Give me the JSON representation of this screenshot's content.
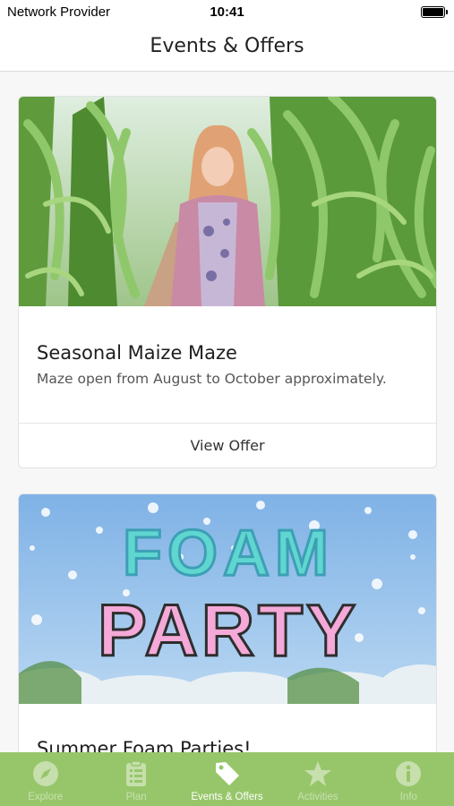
{
  "status_bar": {
    "carrier": "Network Provider",
    "time": "10:41"
  },
  "header": {
    "title": "Events & Offers"
  },
  "offers": [
    {
      "title": "Seasonal Maize Maze",
      "description": "Maze open from August to October approximately.",
      "cta": "View Offer"
    },
    {
      "image_text_top": "FOAM",
      "image_text_bottom": "PARTY",
      "title": "Summer Foam Parties!"
    }
  ],
  "tabs": [
    {
      "label": "Explore",
      "icon": "compass-icon"
    },
    {
      "label": "Plan",
      "icon": "clipboard-icon"
    },
    {
      "label": "Events & Offers",
      "icon": "tag-icon",
      "active": true
    },
    {
      "label": "Activities",
      "icon": "star-icon"
    },
    {
      "label": "Info",
      "icon": "info-icon"
    }
  ],
  "colors": {
    "tab_bar": "#97c66a",
    "header_bg": "#ffffff",
    "card_bg": "#ffffff"
  }
}
